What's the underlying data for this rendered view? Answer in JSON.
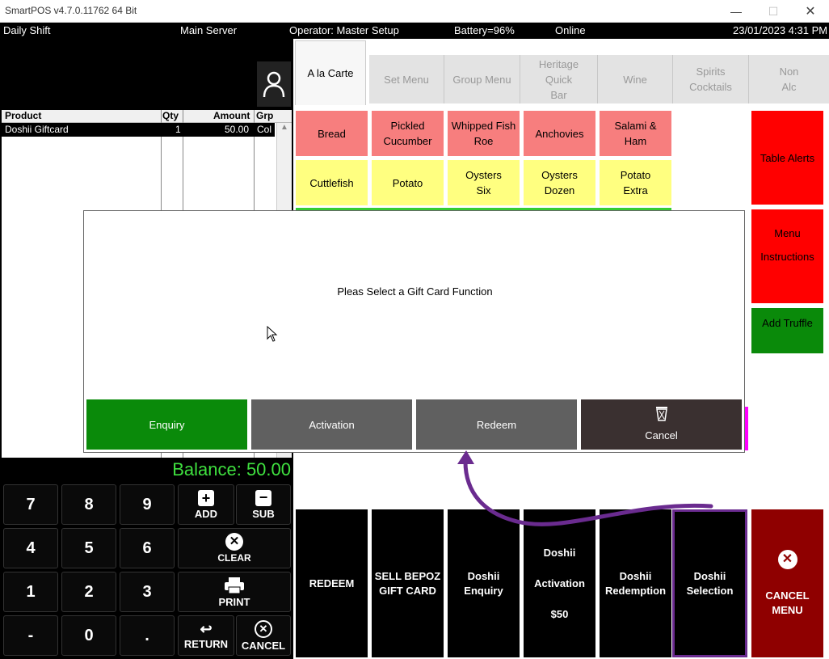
{
  "window": {
    "title": "SmartPOS v4.7.0.11762 64 Bit"
  },
  "status": {
    "shift": "Daily Shift",
    "server": "Main Server",
    "operator": "Operator: Master Setup",
    "battery": "Battery=96%",
    "connection": "Online",
    "datetime": "23/01/2023 4:31 PM"
  },
  "grid": {
    "headers": {
      "product": "Product",
      "qty": "Qty",
      "amount": "Amount",
      "grp": "Grp"
    },
    "rows": [
      {
        "product": "Doshii Giftcard",
        "qty": "1",
        "amount": "50.00",
        "grp": "Col"
      }
    ]
  },
  "tabs": [
    {
      "label": "A la Carte"
    },
    {
      "label": "Set Menu"
    },
    {
      "label": "Group Menu"
    },
    {
      "label": "Heritage Quick Bar"
    },
    {
      "label": "Wine"
    },
    {
      "label": "Spirits Cocktails"
    },
    {
      "label": "Non Alc"
    }
  ],
  "menu": {
    "row1": [
      "Bread",
      "Pickled Cucumber",
      "Whipped Fish Roe",
      "Anchovies",
      "Salami & Ham"
    ],
    "row2": [
      "Cuttlefish",
      "Potato",
      "Oysters Six",
      "Oysters Dozen",
      "Potato Extra"
    ],
    "side": {
      "alerts": "Table Alerts",
      "instructions_1": "Menu",
      "instructions_2": "Instructions",
      "truffle": "Add Truffle"
    }
  },
  "dialog": {
    "message": "Pleas Select a Gift Card Function",
    "buttons": {
      "enquiry": "Enquiry",
      "activation": "Activation",
      "redeem": "Redeem",
      "cancel": "Cancel"
    }
  },
  "balance": "Balance: 50.00",
  "keypad": {
    "digits": [
      "7",
      "8",
      "9",
      "4",
      "5",
      "6",
      "1",
      "2",
      "3",
      "-",
      "0",
      "."
    ],
    "add": "ADD",
    "sub": "SUB",
    "clear": "CLEAR",
    "print": "PRINT",
    "return": "RETURN",
    "cancel": "CANCEL"
  },
  "functions": {
    "redeem": "REDEEM",
    "sell_1": "SELL BEPOZ",
    "sell_2": "GIFT CARD",
    "enquiry_1": "Doshii",
    "enquiry_2": "Enquiry",
    "activation_1": "Doshii",
    "activation_2": "Activation",
    "activation_3": "$50",
    "redemption_1": "Doshii",
    "redemption_2": "Redemption",
    "selection_1": "Doshii",
    "selection_2": "Selection",
    "cancel_1": "CANCEL",
    "cancel_2": "MENU"
  },
  "colors": {
    "highlight": "#6a2b8f",
    "green": "#0a8a0a",
    "red": "#ff0000",
    "dark_red": "#8f0000"
  }
}
